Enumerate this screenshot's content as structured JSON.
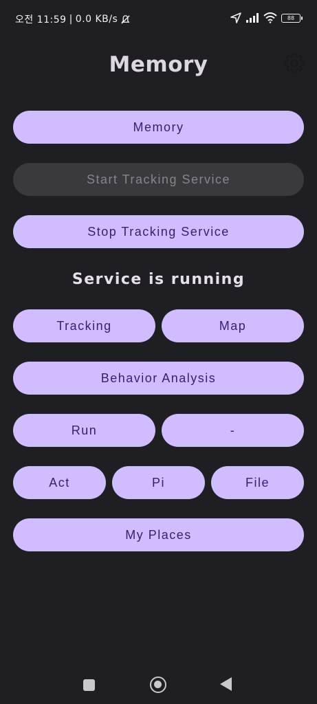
{
  "status_bar": {
    "time": "오전 11:59",
    "separator": "|",
    "network_speed": "0.0 KB/s",
    "battery": "88"
  },
  "header": {
    "title": "Memory"
  },
  "buttons": {
    "memory": "Memory",
    "start_tracking": "Start Tracking Service",
    "stop_tracking": "Stop Tracking Service",
    "tracking": "Tracking",
    "map": "Map",
    "behavior_analysis": "Behavior Analysis",
    "run": "Run",
    "dash": "-",
    "act": "Act",
    "pi": "Pi",
    "file": "File",
    "my_places": "My Places"
  },
  "service_status": "Service is running",
  "colors": {
    "background": "#1f1e23",
    "button_bg": "#d0bcff",
    "button_text": "#381e72",
    "disabled_bg": "#3a393e",
    "disabled_text": "#88858b"
  }
}
